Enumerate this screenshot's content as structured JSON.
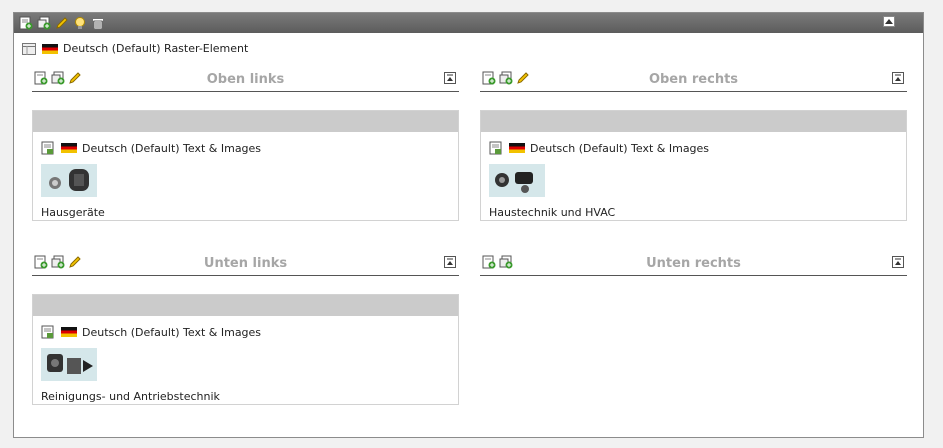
{
  "toolbar": {
    "icons": [
      "new-content-icon",
      "new-record-icon",
      "edit-pencil-icon",
      "hide-bulb-icon",
      "delete-trash-icon"
    ]
  },
  "element": {
    "label": "Deutsch (Default) Raster-Element"
  },
  "columns": [
    {
      "title": "Oben links",
      "items": [
        {
          "label": "Deutsch (Default) Text & Images",
          "caption": "Hausgeräte"
        }
      ]
    },
    {
      "title": "Oben rechts",
      "items": [
        {
          "label": "Deutsch (Default) Text & Images",
          "caption": "Haustechnik und HVAC"
        }
      ]
    },
    {
      "title": "Unten links",
      "items": [
        {
          "label": "Deutsch (Default) Text & Images",
          "caption": "Reinigungs- und Antriebstechnik"
        }
      ]
    },
    {
      "title": "Unten rechts",
      "items": []
    }
  ],
  "colors": {
    "header_bar": "#6b6b6b",
    "column_title": "#a6a6a6",
    "content_bar": "#cbcbcb",
    "flag": [
      "#000000",
      "#dd0000",
      "#ffcc00"
    ]
  }
}
